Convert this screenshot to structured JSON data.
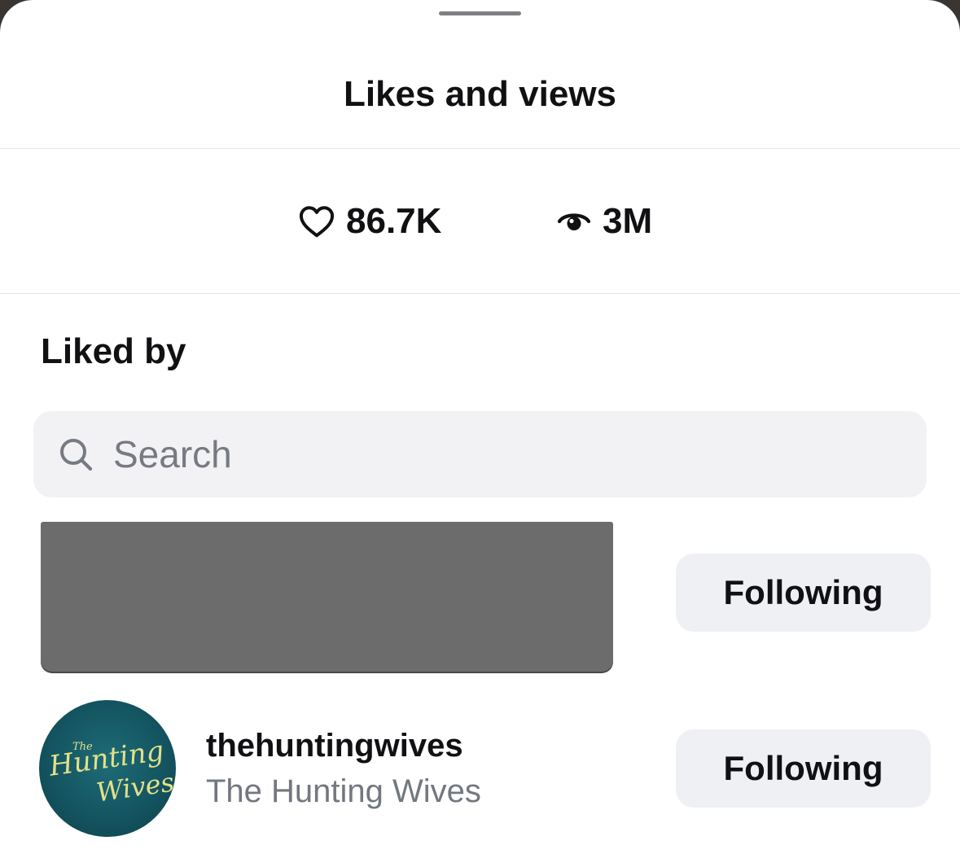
{
  "sheet": {
    "title": "Likes and views"
  },
  "stats": {
    "likes": "86.7K",
    "views": "3M"
  },
  "liked_by": {
    "heading": "Liked by",
    "search_placeholder": "Search",
    "users": [
      {
        "redacted": true,
        "button_label": "Following"
      },
      {
        "username": "thehuntingwives",
        "display_name": "The Hunting Wives",
        "avatar_text_small": "The",
        "avatar_text_line1": "Hunting",
        "avatar_text_line2": "Wives",
        "button_label": "Following"
      }
    ]
  },
  "icons": {
    "likes": "heart-icon",
    "views": "eye-icon",
    "search": "search-icon"
  },
  "colors": {
    "text_primary": "#111114",
    "text_secondary": "#737780",
    "button_bg": "#eff0f4",
    "search_bg": "#f2f2f5",
    "avatar_bg": "#145561",
    "avatar_text": "#e3e08a"
  }
}
